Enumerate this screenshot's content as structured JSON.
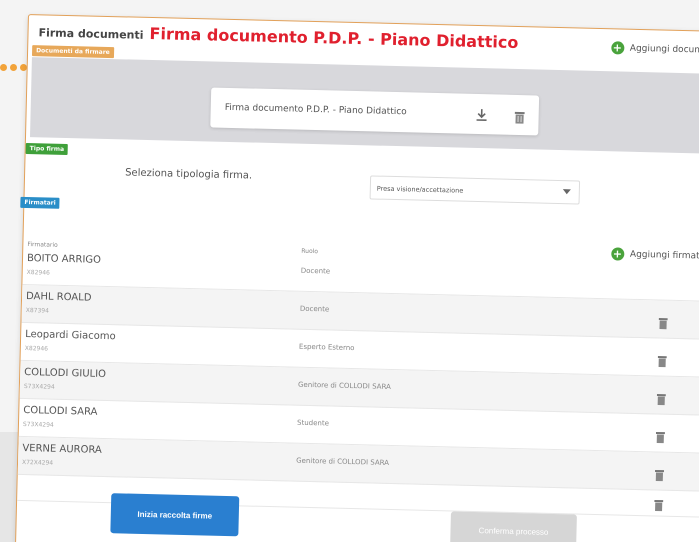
{
  "header": {
    "prefix": "Firma documenti",
    "title": "Firma documento P.D.P. - Piano Didattico",
    "add_document_label": "Aggiungi documenti"
  },
  "tags": {
    "documents": "Documenti da firmare",
    "sign_type": "Tipo firma",
    "signers": "Firmatari"
  },
  "document": {
    "name": "Firma documento P.D.P. - Piano Didattico",
    "download_icon": "download-icon",
    "delete_icon": "trash-icon"
  },
  "sign_type": {
    "label": "Seleziona tipologia firma.",
    "selected": "Presa visione/accettazione"
  },
  "signers": {
    "col_name": "Firmatario",
    "col_role": "Ruolo",
    "add_label": "Aggiungi firmatari",
    "rows": [
      {
        "name": "BOITO ARRIGO",
        "sub": "X82946",
        "role": "Docente"
      },
      {
        "name": "DAHL ROALD",
        "sub": "X87394",
        "role": "Docente"
      },
      {
        "name": "Leopardi Giacomo",
        "sub": "X82946",
        "role": "Esperto Esterno"
      },
      {
        "name": "COLLODI GIULIO",
        "sub": "S73X4294",
        "role": "Genitore di COLLODI SARA"
      },
      {
        "name": "COLLODI SARA",
        "sub": "S73X4294",
        "role": "Studente"
      },
      {
        "name": "VERNE AURORA",
        "sub": "X72X4294",
        "role": "Genitore di COLLODI SARA"
      }
    ]
  },
  "actions": {
    "start": "Inizia raccolta firme",
    "confirm": "Conferma processo"
  },
  "colors": {
    "accent_red": "#e0202e",
    "primary_blue": "#2a7fd0",
    "green": "#4aa33c",
    "orange": "#e7a85a"
  }
}
